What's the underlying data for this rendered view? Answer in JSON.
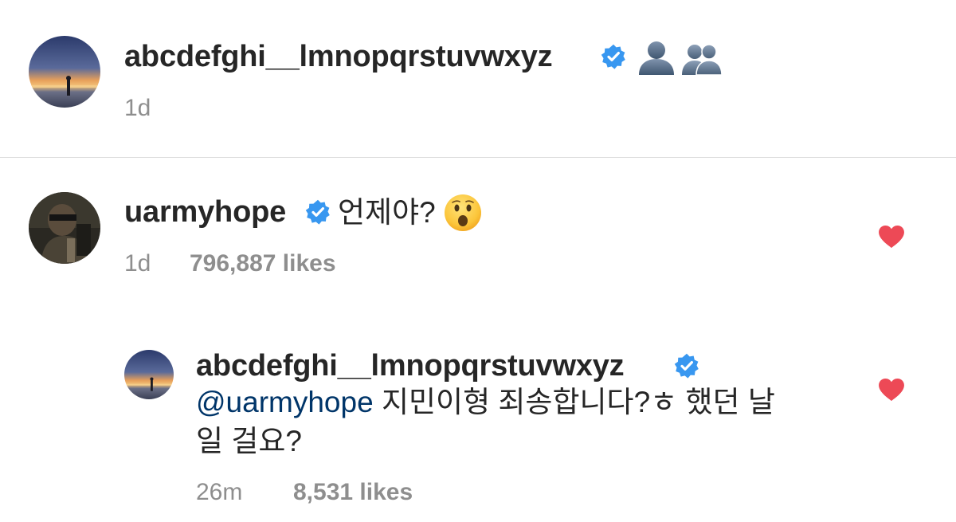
{
  "caption": {
    "username": "abcdefghi__lmnopqrstuvwxyz",
    "emoji_icons": [
      "bust-in-silhouette-icon",
      "busts-in-silhouette-icon"
    ],
    "time": "1d"
  },
  "comment": {
    "username": "uarmyhope",
    "text": "언제야?",
    "emoji": "hushed-face-icon",
    "time": "1d",
    "likes": "796,887 likes",
    "liked": true
  },
  "reply": {
    "username": "abcdefghi__lmnopqrstuvwxyz",
    "mention": "@uarmyhope",
    "text_line1": " 지민이형 죄송합니다?ㅎ 했던 날",
    "text_line2": "일 걸요?",
    "time": "26m",
    "likes": "8,531 likes",
    "liked": true
  },
  "colors": {
    "verified": "#3897f0",
    "heart": "#ed4956",
    "meta": "#8e8e8e",
    "mention": "#003569",
    "divider": "#dbdbdb"
  }
}
